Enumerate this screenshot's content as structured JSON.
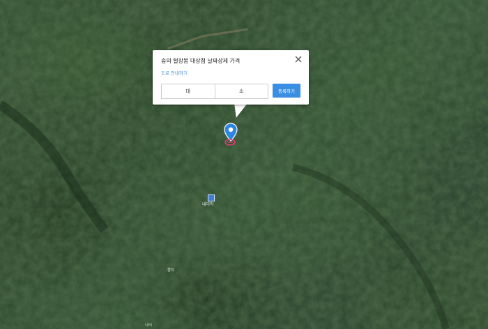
{
  "map": {
    "view": "satellite",
    "terrain": "forested mountain"
  },
  "popup": {
    "title": "숲의 털장봉 대상점 날짜상제 가격",
    "subtitle": "도로 안내하기",
    "tabs": [
      "대",
      "소"
    ],
    "action_label": "등록하기",
    "close_icon": "close-icon"
  },
  "marker": {
    "icon": "location-pin-icon",
    "color": "#2f86e0",
    "badge_color": "#d8417a"
  },
  "trail_point": {
    "icon": "trail-point-icon",
    "label": "내리막"
  },
  "place_labels": [
    {
      "text": "뭉치"
    },
    {
      "text": "나터"
    }
  ]
}
